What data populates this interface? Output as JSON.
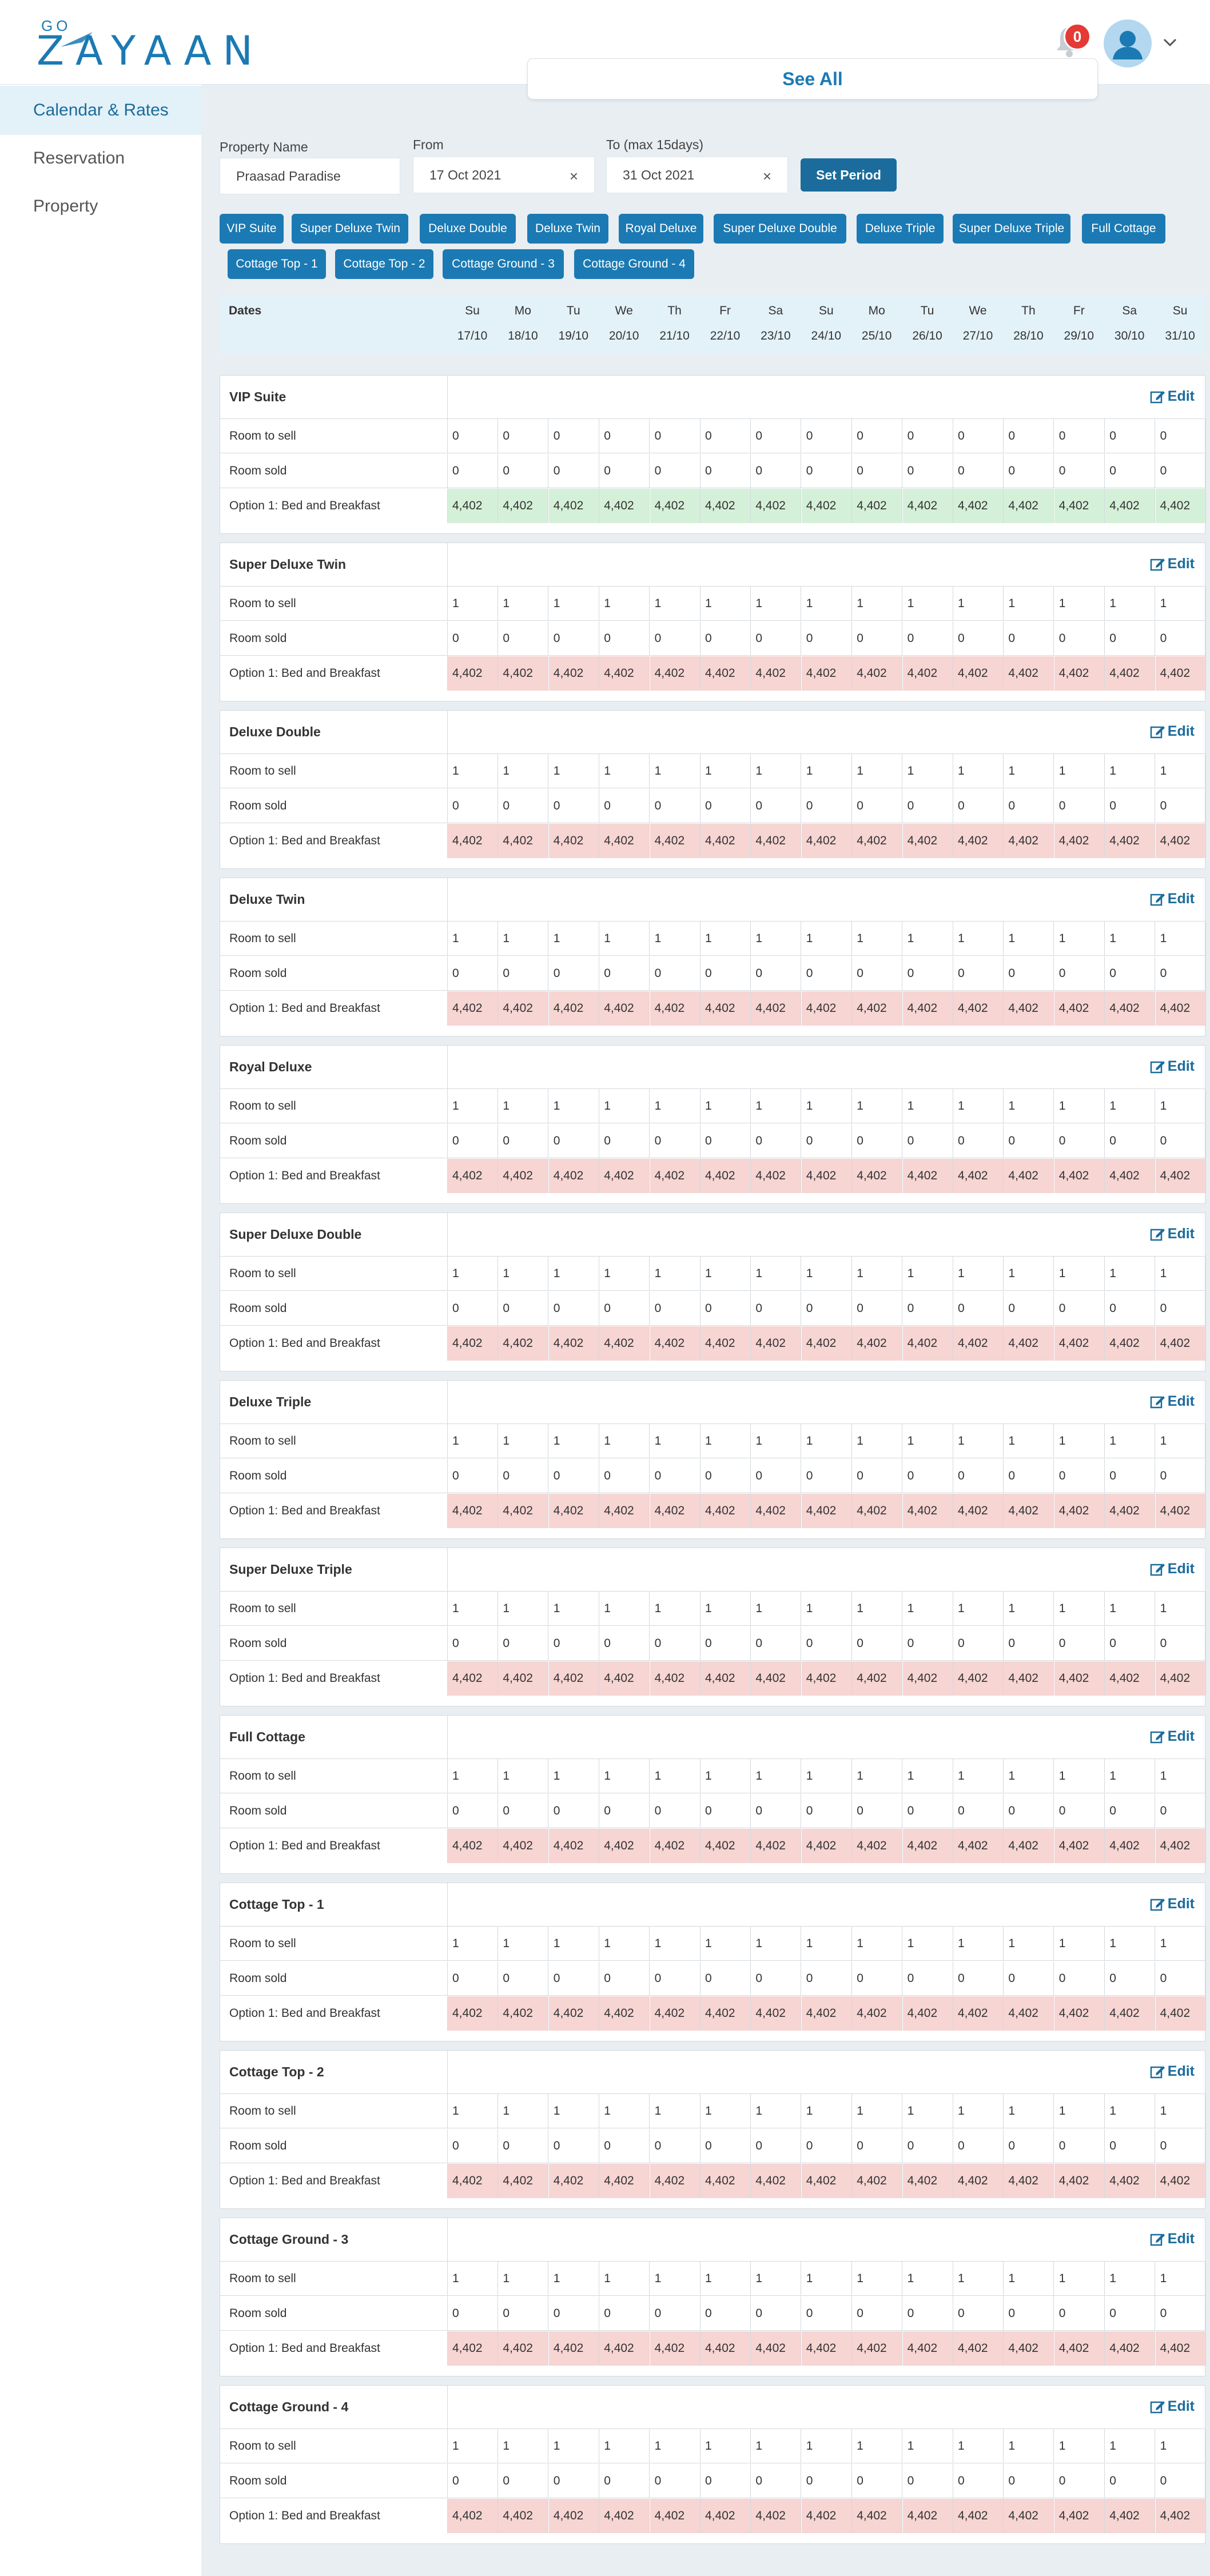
{
  "header": {
    "logo_top": "GO",
    "logo_word": "ZAYAAN",
    "notification_count": "0",
    "see_all_label": "See All"
  },
  "sidebar": {
    "items": [
      {
        "label": "Calendar & Rates",
        "active": true
      },
      {
        "label": "Reservation",
        "active": false
      },
      {
        "label": "Property",
        "active": false
      }
    ]
  },
  "filters": {
    "property_label": "Property Name",
    "property_value": "Praasad Paradise",
    "from_label": "From",
    "from_value": "17 Oct 2021",
    "to_label": "To (max 15days)",
    "to_value": "31 Oct 2021",
    "clear_glyph": "×",
    "set_period_label": "Set Period"
  },
  "room_chips": [
    "VIP Suite",
    "Super Deluxe Twin",
    "Deluxe Double",
    "Deluxe Twin",
    "Royal Deluxe",
    "Super Deluxe Double",
    "Deluxe Triple",
    "Super Deluxe Triple",
    "Full Cottage",
    "Cottage Top - 1",
    "Cottage Top - 2",
    "Cottage Ground - 3",
    "Cottage Ground - 4"
  ],
  "dates": {
    "title": "Dates",
    "days": [
      "Su",
      "Mo",
      "Tu",
      "We",
      "Th",
      "Fr",
      "Sa",
      "Su",
      "Mo",
      "Tu",
      "We",
      "Th",
      "Fr",
      "Sa",
      "Su"
    ],
    "dates": [
      "17/10",
      "18/10",
      "19/10",
      "20/10",
      "21/10",
      "22/10",
      "23/10",
      "24/10",
      "25/10",
      "26/10",
      "27/10",
      "28/10",
      "29/10",
      "30/10",
      "31/10"
    ]
  },
  "edit_label": "Edit",
  "row_labels": {
    "to_sell": "Room to sell",
    "sold": "Room sold",
    "option": "Option 1: Bed and Breakfast"
  },
  "colors": {
    "brand": "#1b7ab3",
    "rate_ok": "#d5f0d8",
    "rate_alert": "#f6d5d3"
  },
  "rooms": [
    {
      "name": "VIP Suite",
      "to_sell": [
        "0",
        "0",
        "0",
        "0",
        "0",
        "0",
        "0",
        "0",
        "0",
        "0",
        "0",
        "0",
        "0",
        "0",
        "0"
      ],
      "sold": [
        "0",
        "0",
        "0",
        "0",
        "0",
        "0",
        "0",
        "0",
        "0",
        "0",
        "0",
        "0",
        "0",
        "0",
        "0"
      ],
      "rates": [
        "4,402",
        "4,402",
        "4,402",
        "4,402",
        "4,402",
        "4,402",
        "4,402",
        "4,402",
        "4,402",
        "4,402",
        "4,402",
        "4,402",
        "4,402",
        "4,402",
        "4,402"
      ],
      "rate_status": "green"
    },
    {
      "name": "Super Deluxe Twin",
      "to_sell": [
        "1",
        "1",
        "1",
        "1",
        "1",
        "1",
        "1",
        "1",
        "1",
        "1",
        "1",
        "1",
        "1",
        "1",
        "1"
      ],
      "sold": [
        "0",
        "0",
        "0",
        "0",
        "0",
        "0",
        "0",
        "0",
        "0",
        "0",
        "0",
        "0",
        "0",
        "0",
        "0"
      ],
      "rates": [
        "4,402",
        "4,402",
        "4,402",
        "4,402",
        "4,402",
        "4,402",
        "4,402",
        "4,402",
        "4,402",
        "4,402",
        "4,402",
        "4,402",
        "4,402",
        "4,402",
        "4,402"
      ],
      "rate_status": "red"
    },
    {
      "name": "Deluxe Double",
      "to_sell": [
        "1",
        "1",
        "1",
        "1",
        "1",
        "1",
        "1",
        "1",
        "1",
        "1",
        "1",
        "1",
        "1",
        "1",
        "1"
      ],
      "sold": [
        "0",
        "0",
        "0",
        "0",
        "0",
        "0",
        "0",
        "0",
        "0",
        "0",
        "0",
        "0",
        "0",
        "0",
        "0"
      ],
      "rates": [
        "4,402",
        "4,402",
        "4,402",
        "4,402",
        "4,402",
        "4,402",
        "4,402",
        "4,402",
        "4,402",
        "4,402",
        "4,402",
        "4,402",
        "4,402",
        "4,402",
        "4,402"
      ],
      "rate_status": "red"
    },
    {
      "name": "Deluxe Twin",
      "to_sell": [
        "1",
        "1",
        "1",
        "1",
        "1",
        "1",
        "1",
        "1",
        "1",
        "1",
        "1",
        "1",
        "1",
        "1",
        "1"
      ],
      "sold": [
        "0",
        "0",
        "0",
        "0",
        "0",
        "0",
        "0",
        "0",
        "0",
        "0",
        "0",
        "0",
        "0",
        "0",
        "0"
      ],
      "rates": [
        "4,402",
        "4,402",
        "4,402",
        "4,402",
        "4,402",
        "4,402",
        "4,402",
        "4,402",
        "4,402",
        "4,402",
        "4,402",
        "4,402",
        "4,402",
        "4,402",
        "4,402"
      ],
      "rate_status": "red"
    },
    {
      "name": "Royal Deluxe",
      "to_sell": [
        "1",
        "1",
        "1",
        "1",
        "1",
        "1",
        "1",
        "1",
        "1",
        "1",
        "1",
        "1",
        "1",
        "1",
        "1"
      ],
      "sold": [
        "0",
        "0",
        "0",
        "0",
        "0",
        "0",
        "0",
        "0",
        "0",
        "0",
        "0",
        "0",
        "0",
        "0",
        "0"
      ],
      "rates": [
        "4,402",
        "4,402",
        "4,402",
        "4,402",
        "4,402",
        "4,402",
        "4,402",
        "4,402",
        "4,402",
        "4,402",
        "4,402",
        "4,402",
        "4,402",
        "4,402",
        "4,402"
      ],
      "rate_status": "red"
    },
    {
      "name": "Super Deluxe Double",
      "to_sell": [
        "1",
        "1",
        "1",
        "1",
        "1",
        "1",
        "1",
        "1",
        "1",
        "1",
        "1",
        "1",
        "1",
        "1",
        "1"
      ],
      "sold": [
        "0",
        "0",
        "0",
        "0",
        "0",
        "0",
        "0",
        "0",
        "0",
        "0",
        "0",
        "0",
        "0",
        "0",
        "0"
      ],
      "rates": [
        "4,402",
        "4,402",
        "4,402",
        "4,402",
        "4,402",
        "4,402",
        "4,402",
        "4,402",
        "4,402",
        "4,402",
        "4,402",
        "4,402",
        "4,402",
        "4,402",
        "4,402"
      ],
      "rate_status": "red"
    },
    {
      "name": "Deluxe Triple",
      "to_sell": [
        "1",
        "1",
        "1",
        "1",
        "1",
        "1",
        "1",
        "1",
        "1",
        "1",
        "1",
        "1",
        "1",
        "1",
        "1"
      ],
      "sold": [
        "0",
        "0",
        "0",
        "0",
        "0",
        "0",
        "0",
        "0",
        "0",
        "0",
        "0",
        "0",
        "0",
        "0",
        "0"
      ],
      "rates": [
        "4,402",
        "4,402",
        "4,402",
        "4,402",
        "4,402",
        "4,402",
        "4,402",
        "4,402",
        "4,402",
        "4,402",
        "4,402",
        "4,402",
        "4,402",
        "4,402",
        "4,402"
      ],
      "rate_status": "red"
    },
    {
      "name": "Super Deluxe Triple",
      "to_sell": [
        "1",
        "1",
        "1",
        "1",
        "1",
        "1",
        "1",
        "1",
        "1",
        "1",
        "1",
        "1",
        "1",
        "1",
        "1"
      ],
      "sold": [
        "0",
        "0",
        "0",
        "0",
        "0",
        "0",
        "0",
        "0",
        "0",
        "0",
        "0",
        "0",
        "0",
        "0",
        "0"
      ],
      "rates": [
        "4,402",
        "4,402",
        "4,402",
        "4,402",
        "4,402",
        "4,402",
        "4,402",
        "4,402",
        "4,402",
        "4,402",
        "4,402",
        "4,402",
        "4,402",
        "4,402",
        "4,402"
      ],
      "rate_status": "red"
    },
    {
      "name": "Full Cottage",
      "to_sell": [
        "1",
        "1",
        "1",
        "1",
        "1",
        "1",
        "1",
        "1",
        "1",
        "1",
        "1",
        "1",
        "1",
        "1",
        "1"
      ],
      "sold": [
        "0",
        "0",
        "0",
        "0",
        "0",
        "0",
        "0",
        "0",
        "0",
        "0",
        "0",
        "0",
        "0",
        "0",
        "0"
      ],
      "rates": [
        "4,402",
        "4,402",
        "4,402",
        "4,402",
        "4,402",
        "4,402",
        "4,402",
        "4,402",
        "4,402",
        "4,402",
        "4,402",
        "4,402",
        "4,402",
        "4,402",
        "4,402"
      ],
      "rate_status": "red"
    },
    {
      "name": "Cottage Top - 1",
      "to_sell": [
        "1",
        "1",
        "1",
        "1",
        "1",
        "1",
        "1",
        "1",
        "1",
        "1",
        "1",
        "1",
        "1",
        "1",
        "1"
      ],
      "sold": [
        "0",
        "0",
        "0",
        "0",
        "0",
        "0",
        "0",
        "0",
        "0",
        "0",
        "0",
        "0",
        "0",
        "0",
        "0"
      ],
      "rates": [
        "4,402",
        "4,402",
        "4,402",
        "4,402",
        "4,402",
        "4,402",
        "4,402",
        "4,402",
        "4,402",
        "4,402",
        "4,402",
        "4,402",
        "4,402",
        "4,402",
        "4,402"
      ],
      "rate_status": "red"
    },
    {
      "name": "Cottage Top - 2",
      "to_sell": [
        "1",
        "1",
        "1",
        "1",
        "1",
        "1",
        "1",
        "1",
        "1",
        "1",
        "1",
        "1",
        "1",
        "1",
        "1"
      ],
      "sold": [
        "0",
        "0",
        "0",
        "0",
        "0",
        "0",
        "0",
        "0",
        "0",
        "0",
        "0",
        "0",
        "0",
        "0",
        "0"
      ],
      "rates": [
        "4,402",
        "4,402",
        "4,402",
        "4,402",
        "4,402",
        "4,402",
        "4,402",
        "4,402",
        "4,402",
        "4,402",
        "4,402",
        "4,402",
        "4,402",
        "4,402",
        "4,402"
      ],
      "rate_status": "red"
    },
    {
      "name": "Cottage Ground - 3",
      "to_sell": [
        "1",
        "1",
        "1",
        "1",
        "1",
        "1",
        "1",
        "1",
        "1",
        "1",
        "1",
        "1",
        "1",
        "1",
        "1"
      ],
      "sold": [
        "0",
        "0",
        "0",
        "0",
        "0",
        "0",
        "0",
        "0",
        "0",
        "0",
        "0",
        "0",
        "0",
        "0",
        "0"
      ],
      "rates": [
        "4,402",
        "4,402",
        "4,402",
        "4,402",
        "4,402",
        "4,402",
        "4,402",
        "4,402",
        "4,402",
        "4,402",
        "4,402",
        "4,402",
        "4,402",
        "4,402",
        "4,402"
      ],
      "rate_status": "red"
    },
    {
      "name": "Cottage Ground - 4",
      "to_sell": [
        "1",
        "1",
        "1",
        "1",
        "1",
        "1",
        "1",
        "1",
        "1",
        "1",
        "1",
        "1",
        "1",
        "1",
        "1"
      ],
      "sold": [
        "0",
        "0",
        "0",
        "0",
        "0",
        "0",
        "0",
        "0",
        "0",
        "0",
        "0",
        "0",
        "0",
        "0",
        "0"
      ],
      "rates": [
        "4,402",
        "4,402",
        "4,402",
        "4,402",
        "4,402",
        "4,402",
        "4,402",
        "4,402",
        "4,402",
        "4,402",
        "4,402",
        "4,402",
        "4,402",
        "4,402",
        "4,402"
      ],
      "rate_status": "red"
    }
  ]
}
